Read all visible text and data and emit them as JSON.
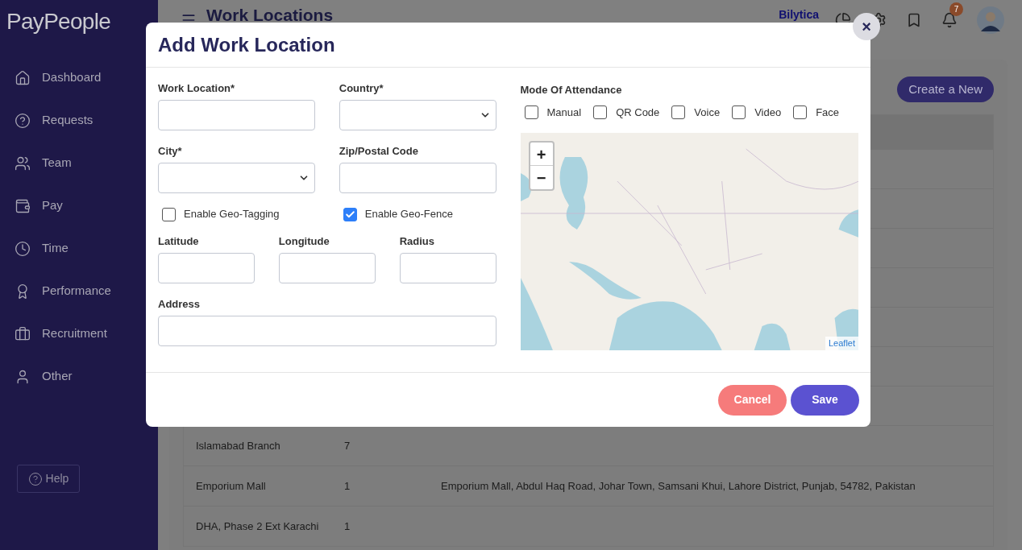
{
  "sidebar": {
    "logo": "PayPeople",
    "items": [
      {
        "label": "Dashboard"
      },
      {
        "label": "Requests"
      },
      {
        "label": "Team"
      },
      {
        "label": "Pay"
      },
      {
        "label": "Time"
      },
      {
        "label": "Performance"
      },
      {
        "label": "Recruitment"
      },
      {
        "label": "Other"
      }
    ],
    "help": "Help"
  },
  "header": {
    "title": "Work Locations",
    "company": "Bilytica",
    "notifications": "7"
  },
  "content": {
    "create_button": "Create a New",
    "rows": [
      {
        "name": "Islamabad Branch",
        "count": "7"
      },
      {
        "name": "Emporium Mall",
        "count": "1",
        "address": "Emporium Mall, Abdul Haq Road, Johar Town, Samsani Khui, Lahore District, Punjab, 54782, Pakistan"
      },
      {
        "name": "DHA, Phase 2 Ext Karachi",
        "count": "1"
      }
    ]
  },
  "modal": {
    "title": "Add Work Location",
    "close": "×",
    "fields": {
      "work_location": {
        "label": "Work Location*"
      },
      "country": {
        "label": "Country*"
      },
      "city": {
        "label": "City*"
      },
      "zip": {
        "label": "Zip/Postal Code"
      },
      "latitude": {
        "label": "Latitude"
      },
      "longitude": {
        "label": "Longitude"
      },
      "radius": {
        "label": "Radius"
      },
      "address": {
        "label": "Address"
      }
    },
    "geo_options": [
      {
        "label": "Enable Geo-Tagging",
        "checked": false
      },
      {
        "label": "Enable Geo-Fence",
        "checked": true
      }
    ],
    "attendance": {
      "label": "Mode Of Attendance",
      "modes": [
        {
          "label": "Manual",
          "checked": false
        },
        {
          "label": "QR Code",
          "checked": false
        },
        {
          "label": "Voice",
          "checked": false
        },
        {
          "label": "Video",
          "checked": false
        },
        {
          "label": "Face",
          "checked": false
        }
      ]
    },
    "map": {
      "zoom_in": "+",
      "zoom_out": "−",
      "attribution": "Leaflet"
    },
    "buttons": {
      "cancel": "Cancel",
      "save": "Save"
    }
  }
}
